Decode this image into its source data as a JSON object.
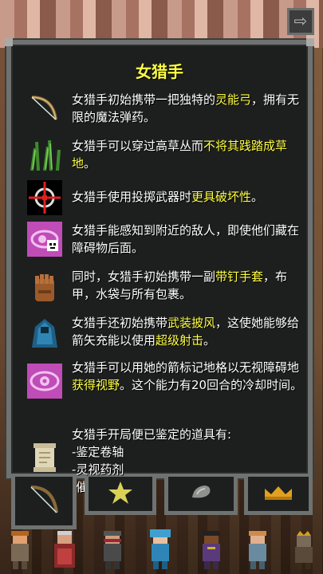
{
  "window": {
    "title": "女猎手"
  },
  "rows": [
    {
      "icon": "spirit-bow-icon",
      "parts": [
        {
          "t": "女猎手初始携带一把独特的",
          "hl": false
        },
        {
          "t": "灵能弓",
          "hl": true
        },
        {
          "t": "，拥有无限的魔法弹药。",
          "hl": false
        }
      ]
    },
    {
      "icon": "tall-grass-icon",
      "parts": [
        {
          "t": "女猎手可以穿过高草丛而",
          "hl": false
        },
        {
          "t": "不将其践踏成草地",
          "hl": true
        },
        {
          "t": "。",
          "hl": false
        }
      ]
    },
    {
      "icon": "crosshair-icon",
      "parts": [
        {
          "t": "女猎手使用投掷武器时",
          "hl": false
        },
        {
          "t": "更具破坏性",
          "hl": true
        },
        {
          "t": "。",
          "hl": false
        }
      ]
    },
    {
      "icon": "mind-vision-icon",
      "parts": [
        {
          "t": "女猎手能感知到附近的敌人，即使他们藏在障碍物后面。",
          "hl": false
        }
      ]
    },
    {
      "icon": "gloves-icon",
      "parts": [
        {
          "t": "同时，女猎手初始携带一副",
          "hl": false
        },
        {
          "t": "带钉手套",
          "hl": true
        },
        {
          "t": "，布甲，水袋与所有包裹。",
          "hl": false
        }
      ]
    },
    {
      "icon": "cloak-icon",
      "parts": [
        {
          "t": "女猎手还初始携带",
          "hl": false
        },
        {
          "t": "武装披风",
          "hl": true
        },
        {
          "t": "，这使她能够给箭矢充能以使用",
          "hl": false
        },
        {
          "t": "超级射击",
          "hl": true
        },
        {
          "t": "。",
          "hl": false
        }
      ]
    },
    {
      "icon": "eye-icon",
      "parts": [
        {
          "t": "女猎手可以用她的箭标记地格以无视障碍地",
          "hl": false
        },
        {
          "t": "获得视野",
          "hl": true
        },
        {
          "t": "。这个能力有20回合的冷却时间。",
          "hl": false
        }
      ]
    },
    {
      "icon": "scroll-icon",
      "parts": [
        {
          "t": "女猎手开局便已鉴定的道具有:\n-鉴定卷轴\n-灵视药剂\n-催眠卷轴",
          "hl": false
        }
      ]
    }
  ],
  "tabs": [
    {
      "name": "tab-bow",
      "icon": "bow-icon"
    },
    {
      "name": "tab-star",
      "icon": "star-icon"
    },
    {
      "name": "tab-stone",
      "icon": "stone-icon"
    },
    {
      "name": "tab-crown",
      "icon": "crown-icon"
    }
  ],
  "heroes": [
    "warrior",
    "mage",
    "rogue",
    "huntress",
    "duelist",
    "cleric",
    "rat-king"
  ],
  "colors": {
    "highlight": "#ffff44",
    "text": "#ffffff",
    "panel": "#1d1f1e",
    "border": "#6e7270"
  }
}
